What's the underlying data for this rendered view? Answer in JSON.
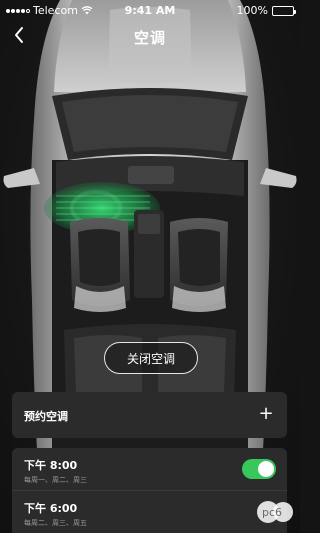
{
  "status_bar": {
    "carrier": "Telecom",
    "time": "9:41 AM",
    "battery": "100%"
  },
  "nav": {
    "title": "空调",
    "back_icon": "chevron-left-icon"
  },
  "car": {
    "airflow_color": "#2fd06a",
    "body_color": "#a9a9a9"
  },
  "close_ac": {
    "label": "关闭空调"
  },
  "schedule": {
    "label": "预约空调",
    "add_icon": "plus-icon",
    "add_label": "+"
  },
  "timers": [
    {
      "time": "下午 8:00",
      "days": "每周一、周二、周三",
      "enabled": true
    },
    {
      "time": "下午 6:00",
      "days": "每周二、周三、周五",
      "enabled": null
    }
  ],
  "colors": {
    "toggle_on": "#38c75a",
    "card_bg": "#2b2b2b",
    "page_bg": "#141414"
  },
  "watermark": {
    "text": "pc6"
  }
}
